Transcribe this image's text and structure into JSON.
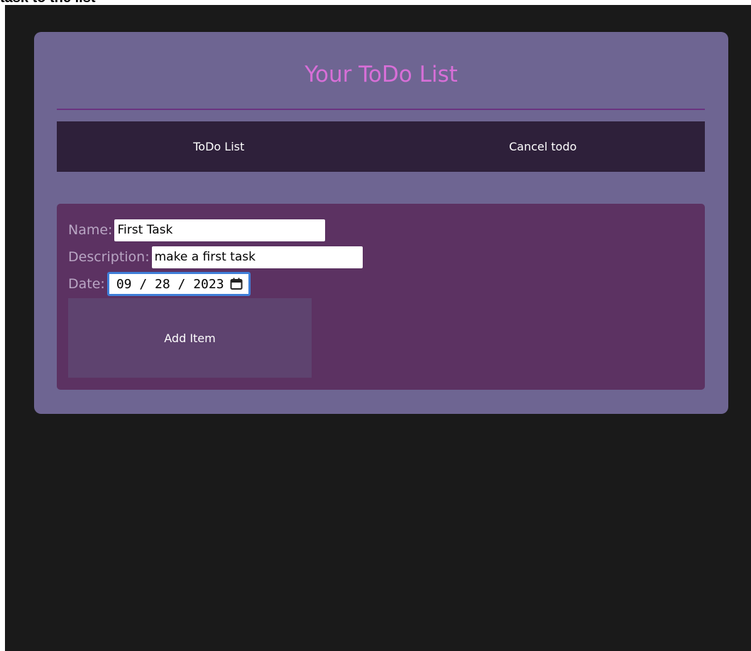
{
  "page": {
    "top_caption": "task to the list"
  },
  "card": {
    "title": "Your ToDo List"
  },
  "tabs": [
    {
      "label": "ToDo List"
    },
    {
      "label": "Cancel todo"
    }
  ],
  "form": {
    "name_label": "Name:",
    "name_value": "First Task",
    "description_label": "Description:",
    "description_value": "make a first task",
    "date_label": "Date:",
    "date_value": "09 / 28 / 2023",
    "add_button_label": "Add Item"
  },
  "icons": {
    "calendar": "calendar-icon"
  },
  "colors": {
    "background": "#1a1a1a",
    "card": "#6e6592",
    "title": "#d86fd8",
    "tabbar": "#2e203a",
    "form_panel": "#5c3262",
    "add_button": "#5e436f",
    "date_focus": "#3f7fd8"
  }
}
